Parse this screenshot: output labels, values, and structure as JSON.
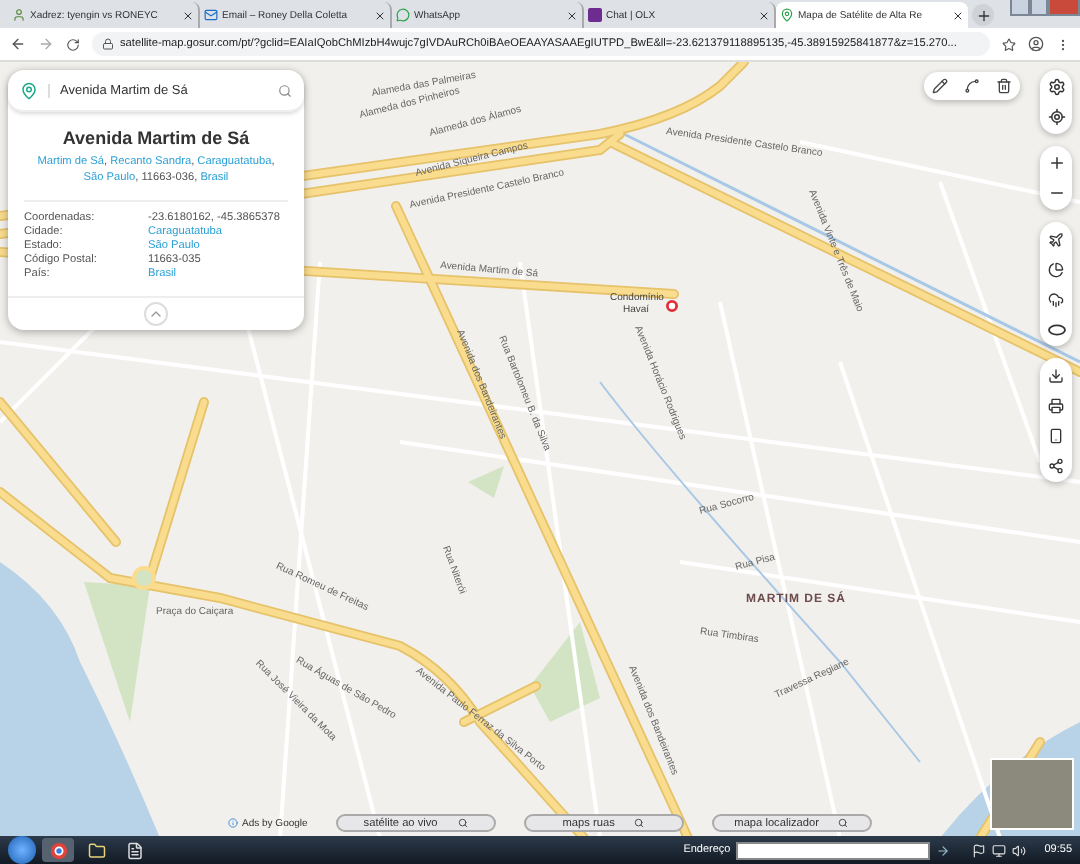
{
  "browser": {
    "tabs": [
      {
        "title": "Xadrez: tyengin vs RONEYC",
        "selected": false
      },
      {
        "title": "Email – Roney Della Coletta",
        "selected": false
      },
      {
        "title": "WhatsApp",
        "selected": false
      },
      {
        "title": "Chat | OLX",
        "selected": false
      },
      {
        "title": "Mapa de Satélite de Alta Re",
        "selected": true
      }
    ],
    "address": "satellite-map.gosur.com/pt/?gclid=EAIaIQobChMIzbH4wujc7gIVDAuRCh0iBAeOEAAYASAAEgIUTPD_BwE&ll=-23.621379118895135,-45.38915925841877&z=15.270..."
  },
  "place_panel": {
    "search_value": "Avenida Martim de Sá",
    "title": "Avenida Martim de Sá",
    "address": [
      {
        "text": "Martim de Sá",
        "link": true
      },
      {
        "text": ", ",
        "link": false
      },
      {
        "text": "Recanto Sandra",
        "link": true
      },
      {
        "text": ", ",
        "link": false
      },
      {
        "text": "Caraguatatuba",
        "link": true
      },
      {
        "text": ", ",
        "link": false
      },
      {
        "text": "São Paulo",
        "link": true
      },
      {
        "text": ", 11663-036, ",
        "link": false
      },
      {
        "text": "Brasil",
        "link": true
      }
    ],
    "details": [
      {
        "label": "Coordenadas:",
        "value": "-23.6180162, -45.3865378",
        "link": false
      },
      {
        "label": "Cidade:",
        "value": "Caraguatatuba",
        "link": true
      },
      {
        "label": "Estado:",
        "value": "São Paulo",
        "link": true
      },
      {
        "label": "Código Postal:",
        "value": "11663-035",
        "link": false
      },
      {
        "label": "País:",
        "value": "Brasil",
        "link": true
      }
    ]
  },
  "map": {
    "labels": [
      {
        "text": "Alameda das Palmeiras",
        "kind": "street"
      },
      {
        "text": "Alameda dos Pinheiros",
        "kind": "street"
      },
      {
        "text": "Alameda dos Álamos",
        "kind": "street"
      },
      {
        "text": "Avenida Siqueira Campos",
        "kind": "street"
      },
      {
        "text": "Avenida Presidente Castelo Branco",
        "kind": "street"
      },
      {
        "text": "Avenida Presidente Castelo Branco",
        "kind": "street"
      },
      {
        "text": "Avenida Martim de Sá",
        "kind": "street"
      },
      {
        "text": "Rua Bartolomeu B. da Silva",
        "kind": "street"
      },
      {
        "text": "Avenida Horácio Rodrigues",
        "kind": "street"
      },
      {
        "text": "Avenida Vinte e Três de Maio",
        "kind": "street"
      },
      {
        "text": "Avenida dos Bandeirantes",
        "kind": "street"
      },
      {
        "text": "Rua Niterói",
        "kind": "street"
      },
      {
        "text": "Rua Romeu de Freitas",
        "kind": "street"
      },
      {
        "text": "Praça do Caiçara",
        "kind": "place"
      },
      {
        "text": "Rua Socorro",
        "kind": "street"
      },
      {
        "text": "Rua Pisa",
        "kind": "street"
      },
      {
        "text": "MARTIM DE SÁ",
        "kind": "district"
      },
      {
        "text": "Rua Timbiras",
        "kind": "street"
      },
      {
        "text": "Travessa Regiane",
        "kind": "street"
      },
      {
        "text": "Rua Águas de São Pedro",
        "kind": "street"
      },
      {
        "text": "Rua José Vieira da Mota",
        "kind": "street"
      },
      {
        "text": "Avenida Paulo Ferraz da Silva Porto",
        "kind": "street"
      },
      {
        "text": "Avenida dos Bandeirantes",
        "kind": "street"
      }
    ],
    "marker": {
      "label": "Condomínio Havaí"
    }
  },
  "ads": {
    "label": "Ads by Google",
    "searches": [
      "satélite ao vivo",
      "maps ruas",
      "mapa localizador"
    ]
  },
  "taskbar": {
    "address_label": "Endereço",
    "time": "09:55"
  }
}
